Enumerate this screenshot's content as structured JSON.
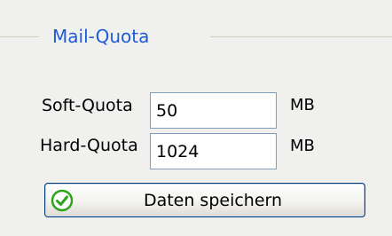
{
  "group": {
    "legend": "Mail-Quota"
  },
  "soft_quota": {
    "label": "Soft-Quota",
    "value": "50",
    "unit": "MB"
  },
  "hard_quota": {
    "label": "Hard-Quota",
    "value": "1024",
    "unit": "MB"
  },
  "save_button": {
    "label": "Daten speichern",
    "icon": "check-circle-icon"
  },
  "colors": {
    "legend": "#1f5bd6",
    "panel_background": "#f0f0ee",
    "input_border": "#7f9db9",
    "button_border": "#003c74",
    "icon_green": "#2fa41b"
  }
}
